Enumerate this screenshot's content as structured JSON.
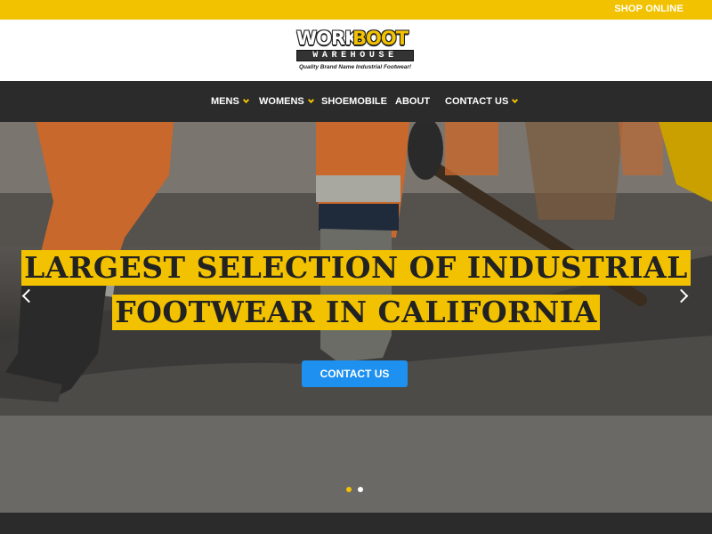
{
  "topbar": {
    "shop_online": "SHOP ONLINE",
    "color": "#f2c200"
  },
  "logo": {
    "word1": "WORK",
    "word2": "BOOT",
    "word3": "WAREHOUSE",
    "tagline": "Quality Brand Name Industrial Footwear!"
  },
  "nav": {
    "items": [
      {
        "label": "MENS",
        "dropdown": true
      },
      {
        "label": "WOMENS",
        "dropdown": true
      },
      {
        "label": "SHOEMOBILE",
        "dropdown": false
      },
      {
        "label": "ABOUT",
        "dropdown": false
      },
      {
        "label": "CONTACT US",
        "dropdown": true
      }
    ]
  },
  "hero": {
    "headline_line1": "LARGEST SELECTION OF INDUSTRIAL",
    "headline_line2": "FOOTWEAR IN CALIFORNIA",
    "cta_label": "CONTACT US",
    "cta_color": "#1e90f0",
    "prev_icon": "chevron-left-icon",
    "next_icon": "chevron-right-icon",
    "slides_count": 2,
    "active_slide": 1
  }
}
